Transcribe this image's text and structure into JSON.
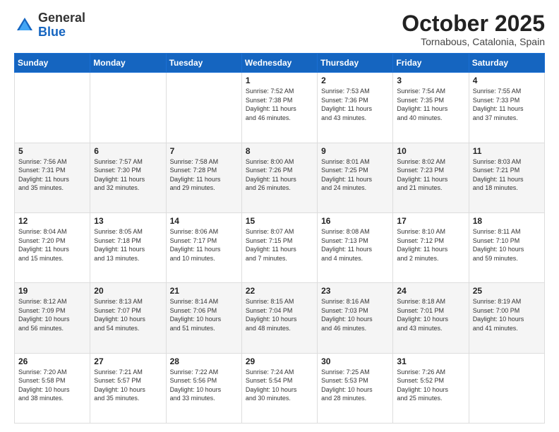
{
  "logo": {
    "general": "General",
    "blue": "Blue"
  },
  "header": {
    "month": "October 2025",
    "location": "Tornabous, Catalonia, Spain"
  },
  "weekdays": [
    "Sunday",
    "Monday",
    "Tuesday",
    "Wednesday",
    "Thursday",
    "Friday",
    "Saturday"
  ],
  "weeks": [
    [
      {
        "day": "",
        "info": ""
      },
      {
        "day": "",
        "info": ""
      },
      {
        "day": "",
        "info": ""
      },
      {
        "day": "1",
        "info": "Sunrise: 7:52 AM\nSunset: 7:38 PM\nDaylight: 11 hours\nand 46 minutes."
      },
      {
        "day": "2",
        "info": "Sunrise: 7:53 AM\nSunset: 7:36 PM\nDaylight: 11 hours\nand 43 minutes."
      },
      {
        "day": "3",
        "info": "Sunrise: 7:54 AM\nSunset: 7:35 PM\nDaylight: 11 hours\nand 40 minutes."
      },
      {
        "day": "4",
        "info": "Sunrise: 7:55 AM\nSunset: 7:33 PM\nDaylight: 11 hours\nand 37 minutes."
      }
    ],
    [
      {
        "day": "5",
        "info": "Sunrise: 7:56 AM\nSunset: 7:31 PM\nDaylight: 11 hours\nand 35 minutes."
      },
      {
        "day": "6",
        "info": "Sunrise: 7:57 AM\nSunset: 7:30 PM\nDaylight: 11 hours\nand 32 minutes."
      },
      {
        "day": "7",
        "info": "Sunrise: 7:58 AM\nSunset: 7:28 PM\nDaylight: 11 hours\nand 29 minutes."
      },
      {
        "day": "8",
        "info": "Sunrise: 8:00 AM\nSunset: 7:26 PM\nDaylight: 11 hours\nand 26 minutes."
      },
      {
        "day": "9",
        "info": "Sunrise: 8:01 AM\nSunset: 7:25 PM\nDaylight: 11 hours\nand 24 minutes."
      },
      {
        "day": "10",
        "info": "Sunrise: 8:02 AM\nSunset: 7:23 PM\nDaylight: 11 hours\nand 21 minutes."
      },
      {
        "day": "11",
        "info": "Sunrise: 8:03 AM\nSunset: 7:21 PM\nDaylight: 11 hours\nand 18 minutes."
      }
    ],
    [
      {
        "day": "12",
        "info": "Sunrise: 8:04 AM\nSunset: 7:20 PM\nDaylight: 11 hours\nand 15 minutes."
      },
      {
        "day": "13",
        "info": "Sunrise: 8:05 AM\nSunset: 7:18 PM\nDaylight: 11 hours\nand 13 minutes."
      },
      {
        "day": "14",
        "info": "Sunrise: 8:06 AM\nSunset: 7:17 PM\nDaylight: 11 hours\nand 10 minutes."
      },
      {
        "day": "15",
        "info": "Sunrise: 8:07 AM\nSunset: 7:15 PM\nDaylight: 11 hours\nand 7 minutes."
      },
      {
        "day": "16",
        "info": "Sunrise: 8:08 AM\nSunset: 7:13 PM\nDaylight: 11 hours\nand 4 minutes."
      },
      {
        "day": "17",
        "info": "Sunrise: 8:10 AM\nSunset: 7:12 PM\nDaylight: 11 hours\nand 2 minutes."
      },
      {
        "day": "18",
        "info": "Sunrise: 8:11 AM\nSunset: 7:10 PM\nDaylight: 10 hours\nand 59 minutes."
      }
    ],
    [
      {
        "day": "19",
        "info": "Sunrise: 8:12 AM\nSunset: 7:09 PM\nDaylight: 10 hours\nand 56 minutes."
      },
      {
        "day": "20",
        "info": "Sunrise: 8:13 AM\nSunset: 7:07 PM\nDaylight: 10 hours\nand 54 minutes."
      },
      {
        "day": "21",
        "info": "Sunrise: 8:14 AM\nSunset: 7:06 PM\nDaylight: 10 hours\nand 51 minutes."
      },
      {
        "day": "22",
        "info": "Sunrise: 8:15 AM\nSunset: 7:04 PM\nDaylight: 10 hours\nand 48 minutes."
      },
      {
        "day": "23",
        "info": "Sunrise: 8:16 AM\nSunset: 7:03 PM\nDaylight: 10 hours\nand 46 minutes."
      },
      {
        "day": "24",
        "info": "Sunrise: 8:18 AM\nSunset: 7:01 PM\nDaylight: 10 hours\nand 43 minutes."
      },
      {
        "day": "25",
        "info": "Sunrise: 8:19 AM\nSunset: 7:00 PM\nDaylight: 10 hours\nand 41 minutes."
      }
    ],
    [
      {
        "day": "26",
        "info": "Sunrise: 7:20 AM\nSunset: 5:58 PM\nDaylight: 10 hours\nand 38 minutes."
      },
      {
        "day": "27",
        "info": "Sunrise: 7:21 AM\nSunset: 5:57 PM\nDaylight: 10 hours\nand 35 minutes."
      },
      {
        "day": "28",
        "info": "Sunrise: 7:22 AM\nSunset: 5:56 PM\nDaylight: 10 hours\nand 33 minutes."
      },
      {
        "day": "29",
        "info": "Sunrise: 7:24 AM\nSunset: 5:54 PM\nDaylight: 10 hours\nand 30 minutes."
      },
      {
        "day": "30",
        "info": "Sunrise: 7:25 AM\nSunset: 5:53 PM\nDaylight: 10 hours\nand 28 minutes."
      },
      {
        "day": "31",
        "info": "Sunrise: 7:26 AM\nSunset: 5:52 PM\nDaylight: 10 hours\nand 25 minutes."
      },
      {
        "day": "",
        "info": ""
      }
    ]
  ]
}
